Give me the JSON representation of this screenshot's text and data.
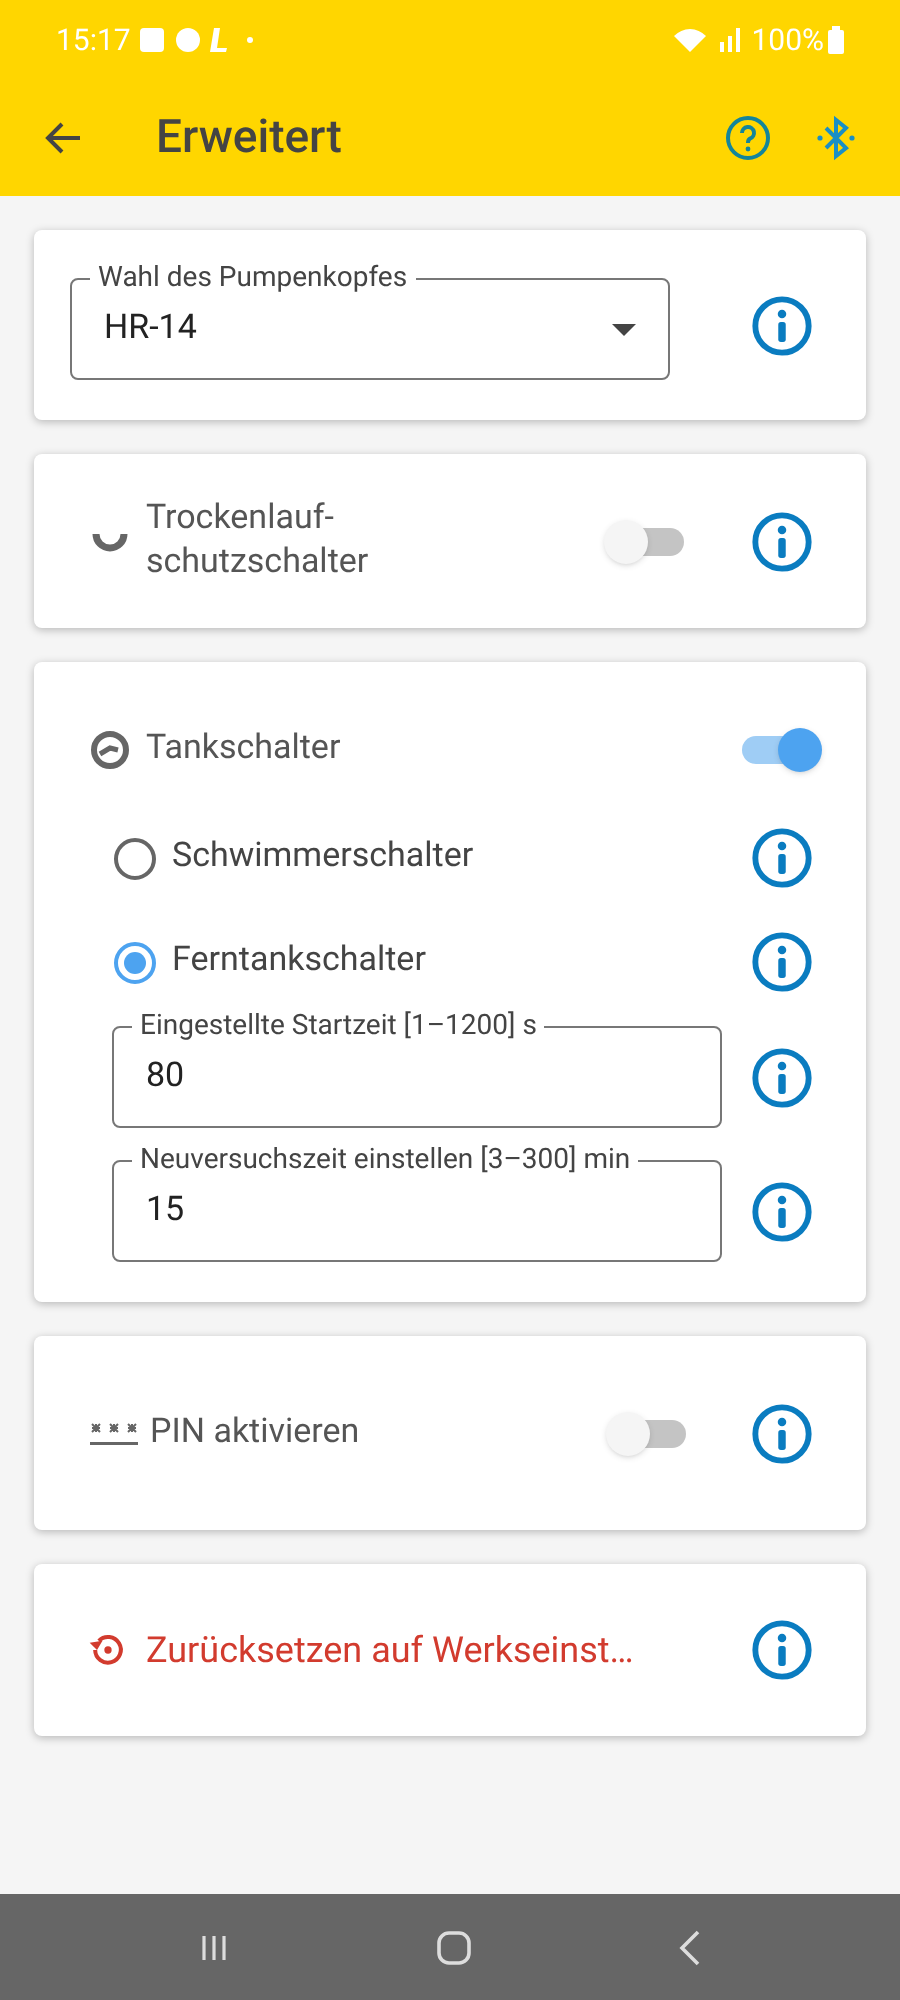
{
  "status_bar": {
    "time": "15:17",
    "battery": "100%"
  },
  "toolbar": {
    "title": "Erweitert"
  },
  "pump_head": {
    "label": "Wahl des Pumpenkopfes",
    "value": "HR-14"
  },
  "dry_run": {
    "label": "Trockenlauf-schutzschalter",
    "on": false
  },
  "tank": {
    "label": "Tankschalter",
    "on": true,
    "options": [
      {
        "label": "Schwimmerschalter",
        "selected": false
      },
      {
        "label": "Ferntankschalter",
        "selected": true
      }
    ],
    "fields": [
      {
        "label": "Eingestellte Startzeit [1–1200] s",
        "value": "80"
      },
      {
        "label": "Neuversuchszeit einstellen [3–300] min",
        "value": "15"
      }
    ]
  },
  "pin": {
    "label": "PIN aktivieren",
    "on": false
  },
  "reset": {
    "label": "Zurücksetzen auf Werkseinst…"
  }
}
